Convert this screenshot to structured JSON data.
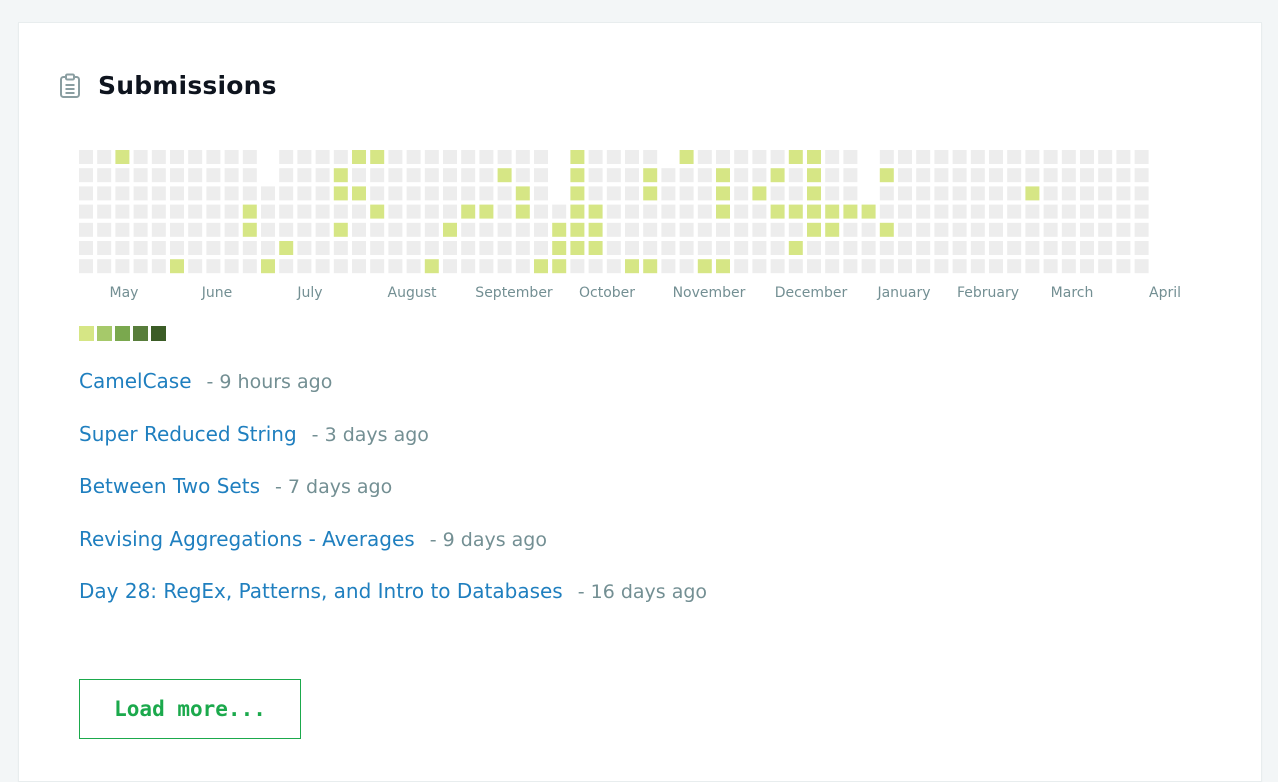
{
  "header": {
    "title": "Submissions",
    "icon": "clipboard-icon"
  },
  "colors": {
    "empty": "#ededed",
    "level1": "#d6e685",
    "levels": [
      "#d6e685",
      "#a6c96a",
      "#7aa84e",
      "#587d3b",
      "#3b5c26"
    ],
    "link": "#1f7fbf",
    "muted": "#738f93",
    "button": "#1ba94c"
  },
  "chart_data": {
    "type": "heatmap",
    "title": "",
    "months": [
      "May",
      "June",
      "July",
      "August",
      "September",
      "October",
      "November",
      "December",
      "January",
      "February",
      "March",
      "April"
    ],
    "weekday_rows": 7,
    "columns": 59,
    "active_cells": [
      [
        2,
        6
      ],
      [
        15,
        6
      ],
      [
        16,
        6
      ],
      [
        26,
        6
      ],
      [
        27,
        6
      ],
      [
        32,
        6
      ],
      [
        33,
        6
      ],
      [
        39,
        6
      ],
      [
        40,
        6
      ],
      [
        14,
        5
      ],
      [
        23,
        5
      ],
      [
        26,
        5
      ],
      [
        27,
        5
      ],
      [
        31,
        5
      ],
      [
        35,
        5
      ],
      [
        38,
        5
      ],
      [
        40,
        5
      ],
      [
        44,
        5
      ],
      [
        14,
        4
      ],
      [
        15,
        4
      ],
      [
        24,
        4
      ],
      [
        26,
        4
      ],
      [
        27,
        4
      ],
      [
        31,
        4
      ],
      [
        35,
        4
      ],
      [
        37,
        4
      ],
      [
        40,
        4
      ],
      [
        52,
        4
      ],
      [
        9,
        3
      ],
      [
        16,
        3
      ],
      [
        21,
        3
      ],
      [
        22,
        3
      ],
      [
        24,
        3
      ],
      [
        27,
        3
      ],
      [
        28,
        3
      ],
      [
        35,
        3
      ],
      [
        38,
        3
      ],
      [
        39,
        3
      ],
      [
        40,
        3
      ],
      [
        41,
        3
      ],
      [
        42,
        3
      ],
      [
        43,
        3
      ],
      [
        9,
        2
      ],
      [
        14,
        2
      ],
      [
        20,
        2
      ],
      [
        26,
        2
      ],
      [
        27,
        2
      ],
      [
        28,
        2
      ],
      [
        40,
        2
      ],
      [
        41,
        2
      ],
      [
        44,
        2
      ],
      [
        11,
        1
      ],
      [
        26,
        1
      ],
      [
        27,
        1
      ],
      [
        28,
        1
      ],
      [
        39,
        1
      ],
      [
        5,
        0
      ],
      [
        10,
        0
      ],
      [
        19,
        0
      ],
      [
        25,
        0
      ],
      [
        26,
        0
      ],
      [
        30,
        0
      ],
      [
        31,
        0
      ],
      [
        34,
        0
      ],
      [
        35,
        0
      ]
    ],
    "active_level": 1,
    "legend_levels": 5
  },
  "submissions": [
    {
      "name": "CamelCase",
      "ago": "- 9 hours ago"
    },
    {
      "name": "Super Reduced String",
      "ago": "- 3 days ago"
    },
    {
      "name": "Between Two Sets",
      "ago": "- 7 days ago"
    },
    {
      "name": "Revising Aggregations - Averages",
      "ago": "- 9 days ago"
    },
    {
      "name": "Day 28: RegEx, Patterns, and Intro to Databases",
      "ago": "- 16 days ago"
    }
  ],
  "load_more_label": "Load more..."
}
